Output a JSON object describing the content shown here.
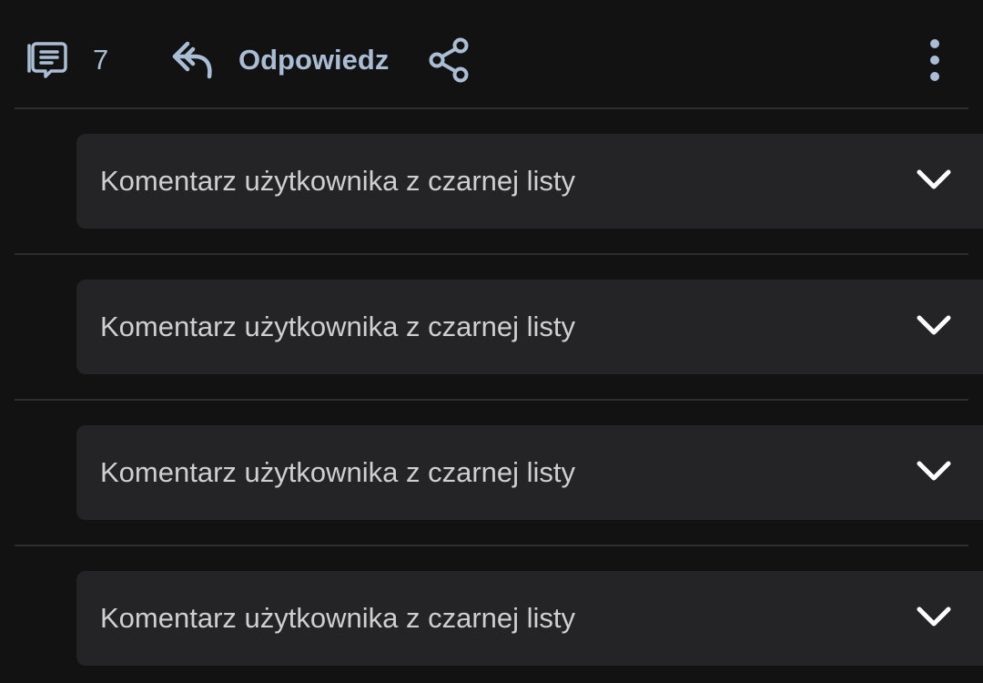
{
  "toolbar": {
    "comments_icon": "comment-list-icon",
    "comment_count": "7",
    "reply_icon": "reply-icon",
    "reply_label": "Odpowiedz",
    "share_icon": "share-icon",
    "more_icon": "more-vertical-icon",
    "accent_color": "#a9bdd4"
  },
  "comments": [
    {
      "text": "Komentarz użytkownika z czarnej listy",
      "icon": "chevron-down-icon"
    },
    {
      "text": "Komentarz użytkownika z czarnej listy",
      "icon": "chevron-down-icon"
    },
    {
      "text": "Komentarz użytkownika z czarnej listy",
      "icon": "chevron-down-icon"
    },
    {
      "text": "Komentarz użytkownika z czarnej listy",
      "icon": "chevron-down-icon"
    }
  ]
}
